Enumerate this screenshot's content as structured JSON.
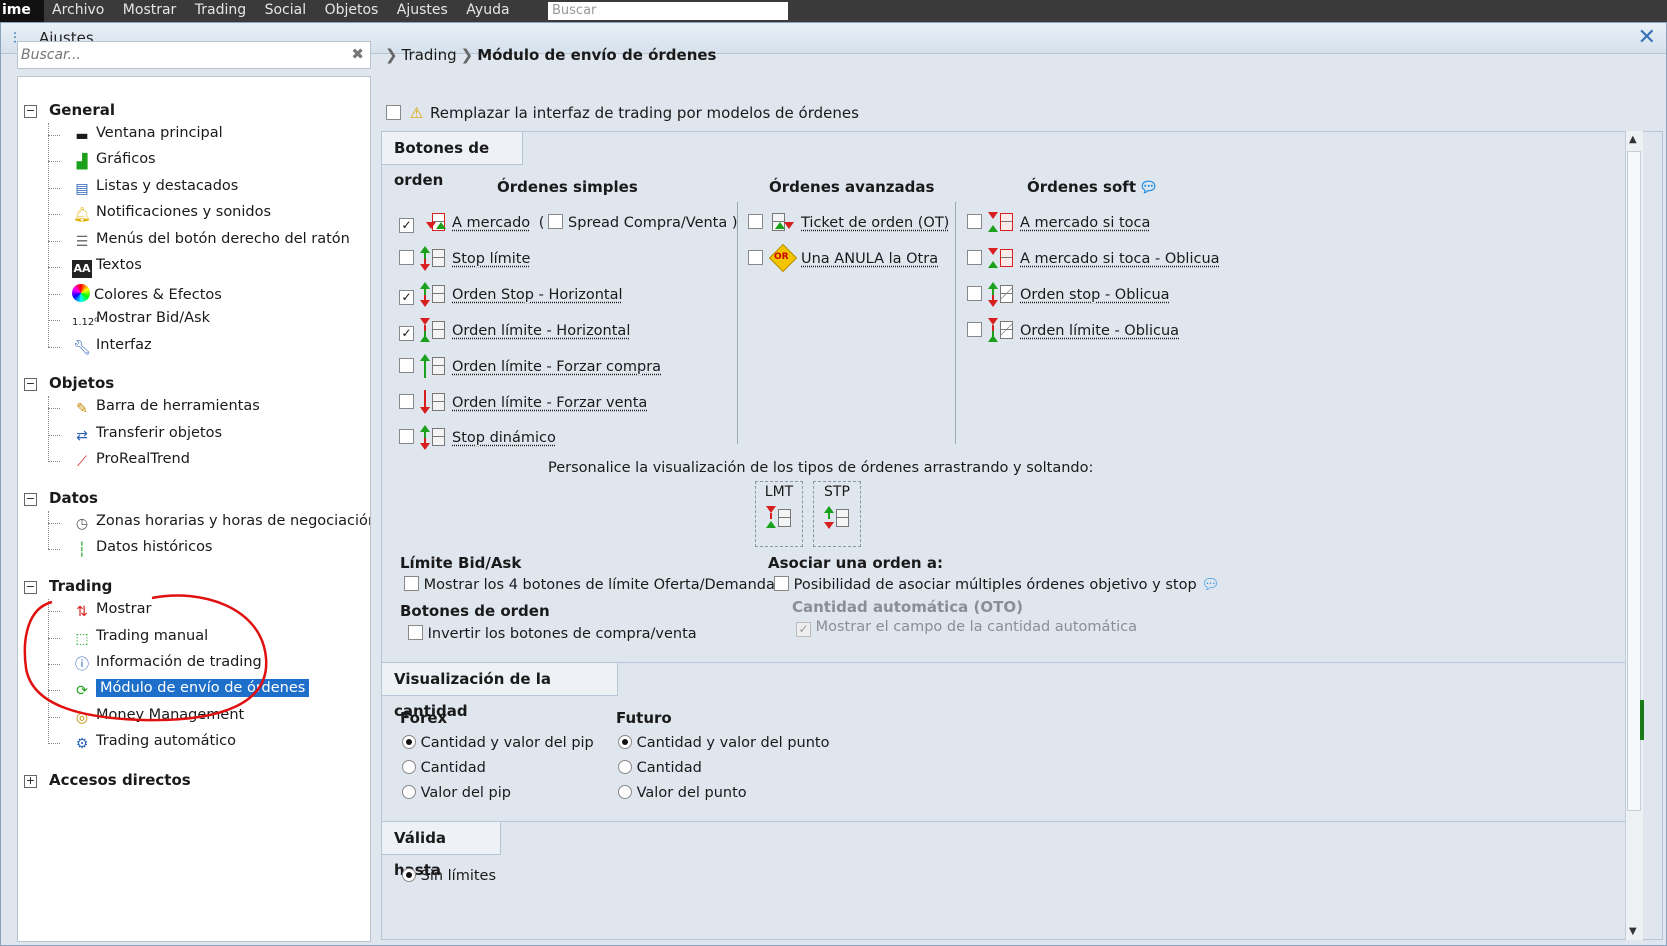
{
  "app": {
    "brand": "ime",
    "menu": [
      "Archivo",
      "Mostrar",
      "Trading",
      "Social",
      "Objetos",
      "Ajustes",
      "Ayuda"
    ],
    "search_placeholder": "Buscar"
  },
  "dialog": {
    "title": "Ajustes...",
    "search_placeholder": "Buscar..."
  },
  "tree": {
    "groups": [
      {
        "label": "General",
        "expander": "−",
        "items": [
          "Ventana principal",
          "Gráficos",
          "Listas y destacados",
          "Notificaciones y sonidos",
          "Menús del botón derecho del ratón",
          "Textos",
          "Colores & Efectos",
          "Mostrar Bid/Ask",
          "Interfaz"
        ]
      },
      {
        "label": "Objetos",
        "expander": "−",
        "items": [
          "Barra de herramientas",
          "Transferir objetos",
          "ProRealTrend"
        ]
      },
      {
        "label": "Datos",
        "expander": "−",
        "items": [
          "Zonas horarias y horas de negociación",
          "Datos históricos"
        ]
      },
      {
        "label": "Trading",
        "expander": "−",
        "items": [
          "Mostrar",
          "Trading manual",
          "Información de trading",
          "Módulo de envío de órdenes",
          "Money Management",
          "Trading automático"
        ]
      },
      {
        "label": "Accesos directos",
        "expander": "+",
        "items": []
      }
    ],
    "bidask_icon_text": "1.12⁰",
    "textos_icon_text": "AA",
    "selected": "Módulo de envío de órdenes"
  },
  "breadcrumb": {
    "parent": "Trading",
    "current": "Módulo de envío de órdenes"
  },
  "replace_interface": {
    "label": "Remplazar la interfaz de trading por modelos de órdenes",
    "checked": false
  },
  "sections": {
    "botones_orden": "Botones de orden",
    "visualizacion_cantidad": "Visualización de la cantidad",
    "valida_hasta": "Válida hasta"
  },
  "columns": {
    "simples": "Órdenes simples",
    "avanzadas": "Órdenes avanzadas",
    "soft": "Órdenes soft"
  },
  "orders_simple": [
    {
      "label": "A mercado",
      "checked": true
    },
    {
      "label": "Stop límite",
      "checked": false
    },
    {
      "label": "Orden Stop - Horizontal",
      "checked": true
    },
    {
      "label": "Orden límite - Horizontal",
      "checked": true
    },
    {
      "label": "Orden límite - Forzar compra",
      "checked": false
    },
    {
      "label": "Orden límite - Forzar venta",
      "checked": false
    },
    {
      "label": "Stop dinámico",
      "checked": false
    }
  ],
  "spread": {
    "open": "(",
    "label": "Spread Compra/Venta",
    "close": ")",
    "checked": false
  },
  "orders_advanced": [
    {
      "label": "Ticket de orden (OT)",
      "checked": false
    },
    {
      "label": "Una ANULA la Otra",
      "checked": false
    }
  ],
  "oco_icon_text": "OR",
  "orders_soft": [
    {
      "label": "A mercado si toca",
      "checked": false
    },
    {
      "label": "A mercado si toca - Oblicua",
      "checked": false
    },
    {
      "label": "Orden stop - Oblicua",
      "checked": false
    },
    {
      "label": "Orden límite - Oblicua",
      "checked": false
    }
  ],
  "customize_text": "Personalice la visualización de los tipos de órdenes arrastrando y soltando:",
  "dnd": [
    "LMT",
    "STP"
  ],
  "limit_bidask": {
    "title": "Límite Bid/Ask",
    "label": "Mostrar los 4 botones de límite Oferta/Demanda.",
    "checked": false
  },
  "order_buttons": {
    "title": "Botones de orden",
    "label": "Invertir los botones de compra/venta",
    "checked": false
  },
  "associate": {
    "title": "Asociar una orden a:",
    "label": "Posibilidad de asociar múltiples órdenes objetivo y stop",
    "checked": false,
    "oto_title": "Cantidad automática (OTO)",
    "oto_label": "Mostrar el campo de la cantidad automática",
    "oto_checked": true
  },
  "forex": {
    "title": "Forex",
    "options": [
      "Cantidad y valor del pip",
      "Cantidad",
      "Valor del pip"
    ],
    "selected": 0
  },
  "futuro": {
    "title": "Futuro",
    "options": [
      "Cantidad y valor del punto",
      "Cantidad",
      "Valor del punto"
    ],
    "selected": 0
  },
  "valid_until": {
    "options": [
      "Sin límites"
    ],
    "selected": 0
  },
  "colors": {
    "accent": "#1d6fc9",
    "buy": "#1aa01a",
    "sell": "#d81e1e",
    "annotation": "#e01010"
  }
}
